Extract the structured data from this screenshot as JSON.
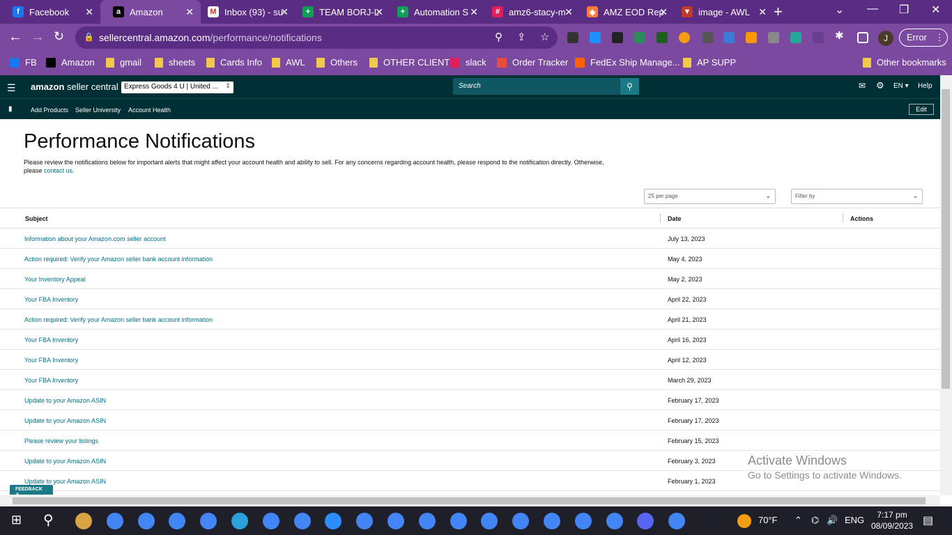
{
  "browser": {
    "tabs": [
      {
        "title": "Facebook",
        "icon": "facebook-icon",
        "color": "#1877f2",
        "glyph": "f"
      },
      {
        "title": "Amazon",
        "icon": "amazon-icon",
        "color": "#000000",
        "glyph": "a"
      },
      {
        "title": "Inbox (93) - su",
        "icon": "gmail-icon",
        "color": "#ffffff",
        "glyph": "M"
      },
      {
        "title": "TEAM BORJ-L",
        "icon": "sheets-icon",
        "color": "#0f9d58",
        "glyph": "+"
      },
      {
        "title": "Automation S",
        "icon": "sheets-icon",
        "color": "#0f9d58",
        "glyph": "+"
      },
      {
        "title": "amz6-stacy-m",
        "icon": "slack-icon",
        "color": "#e01e5a",
        "glyph": "#"
      },
      {
        "title": "AMZ EOD Rep",
        "icon": "clickup-icon",
        "color": "#ff7b3a",
        "glyph": "◆"
      },
      {
        "title": "image - AWL",
        "icon": "awl-icon",
        "color": "#c0392b",
        "glyph": "▼"
      }
    ],
    "url_host": "sellercentral.amazon.com",
    "url_path": "/performance/notifications",
    "profile_initial": "J",
    "error_label": "Error"
  },
  "bookmarks": [
    {
      "label": "FB",
      "icon": "facebook-icon",
      "color": "#1877f2"
    },
    {
      "label": "Amazon",
      "icon": "amazon-icon",
      "color": "#000000"
    },
    {
      "label": "gmail",
      "icon": "folder-icon",
      "color": "#f2c94c"
    },
    {
      "label": "sheets",
      "icon": "folder-icon",
      "color": "#f2c94c"
    },
    {
      "label": "Cards Info",
      "icon": "folder-icon",
      "color": "#f2c94c"
    },
    {
      "label": "AWL",
      "icon": "folder-icon",
      "color": "#f2c94c"
    },
    {
      "label": "Others",
      "icon": "folder-icon",
      "color": "#f2c94c"
    },
    {
      "label": "OTHER CLIENT",
      "icon": "folder-icon",
      "color": "#f2c94c"
    },
    {
      "label": "slack",
      "icon": "slack-icon",
      "color": "#e01e5a"
    },
    {
      "label": "Order Tracker",
      "icon": "plane-icon",
      "color": "#e74c3c"
    },
    {
      "label": "FedEx Ship Manage...",
      "icon": "fedex-icon",
      "color": "#ff6200"
    },
    {
      "label": "AP SUPP",
      "icon": "folder-icon",
      "color": "#f2c94c"
    }
  ],
  "other_bookmarks": "Other bookmarks",
  "seller_central": {
    "logo_main": "amazon",
    "logo_sub": "seller central",
    "account": "Express Goods 4 U | United ...",
    "search_placeholder": "Search",
    "lang": "EN",
    "help": "Help",
    "subnav": [
      "Add Products",
      "Seller University",
      "Account Health"
    ],
    "edit": "Edit"
  },
  "page": {
    "title": "Performance Notifications",
    "description": "Please review the notifications below for important alerts that might affect your account health and ability to sell. For any concerns regarding account health, please respond to the notification directly. Otherwise, please",
    "contact_link": "contact us.",
    "per_page": "25 per page",
    "filter_by": "Filter by",
    "columns": {
      "subject": "Subject",
      "date": "Date",
      "actions": "Actions"
    },
    "rows": [
      {
        "subject": "Information about your Amazon.com seller account",
        "date": "July 13, 2023"
      },
      {
        "subject": "Action required: Verify your Amazon seller bank account information",
        "date": "May 4, 2023"
      },
      {
        "subject": "Your Inventory Appeal",
        "date": "May 2, 2023"
      },
      {
        "subject": "Your FBA Inventory",
        "date": "April 22, 2023"
      },
      {
        "subject": "Action required: Verify your Amazon seller bank account information",
        "date": "April 21, 2023"
      },
      {
        "subject": "Your FBA Inventory",
        "date": "April 16, 2023"
      },
      {
        "subject": "Your FBA Inventory",
        "date": "April 12, 2023"
      },
      {
        "subject": "Your FBA Inventory",
        "date": "March 29, 2023"
      },
      {
        "subject": "Update to your Amazon ASIN",
        "date": "February 17, 2023"
      },
      {
        "subject": "Update to your Amazon ASIN",
        "date": "February 17, 2023"
      },
      {
        "subject": "Please review your listings",
        "date": "February 15, 2023"
      },
      {
        "subject": "Update to your Amazon ASIN",
        "date": "February 3, 2023"
      },
      {
        "subject": "Update to your Amazon ASIN",
        "date": "February 1, 2023"
      }
    ],
    "feedback": "FEEDBACK"
  },
  "watermark": {
    "line1": "Activate Windows",
    "line2": "Go to Settings to activate Windows."
  },
  "taskbar": {
    "weather": "70°F",
    "lang": "ENG",
    "time": "7:17 pm",
    "date": "08/09/2023",
    "apps": [
      "#d9a441",
      "#4285f4",
      "#4285f4",
      "#4285f4",
      "#4285f4",
      "#2aa1da",
      "#4285f4",
      "#4285f4",
      "#2d8cff",
      "#4285f4",
      "#4285f4",
      "#4285f4",
      "#4285f4",
      "#4285f4",
      "#4285f4",
      "#4285f4",
      "#4285f4",
      "#4285f4",
      "#5865f2",
      "#4285f4"
    ]
  }
}
